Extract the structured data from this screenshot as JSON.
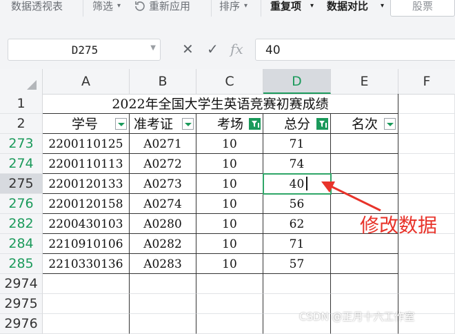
{
  "ribbon": {
    "items": [
      {
        "label": "数据透视表"
      },
      {
        "label": "筛选"
      },
      {
        "label": "重新应用"
      },
      {
        "label": "排序"
      },
      {
        "label": "重复项"
      },
      {
        "label": "数据对比"
      }
    ],
    "search_label": "股票"
  },
  "formula_bar": {
    "name_box": "D275",
    "value": "40",
    "cancel_icon": "close-icon",
    "confirm_icon": "check-icon",
    "function_icon": "fx-icon"
  },
  "columns": [
    "A",
    "B",
    "C",
    "D",
    "E",
    "F"
  ],
  "active_column": "D",
  "rows": [
    "1",
    "2",
    "273",
    "274",
    "275",
    "276",
    "282",
    "284",
    "285",
    "2974",
    "2975",
    "2976"
  ],
  "active_row": "275",
  "sheet": {
    "title": "2022年全国大学生英语竞赛初赛成绩",
    "headers": [
      "学号",
      "准考证",
      "考场",
      "总分",
      "名次"
    ],
    "filtered_columns": [
      "考场",
      "总分"
    ],
    "records": [
      {
        "id": "2200110125",
        "ticket": "A0271",
        "room": "10",
        "score": "71",
        "rank": ""
      },
      {
        "id": "2200110113",
        "ticket": "A0272",
        "room": "10",
        "score": "74",
        "rank": ""
      },
      {
        "id": "2200120133",
        "ticket": "A0273",
        "room": "10",
        "score": "40",
        "rank": ""
      },
      {
        "id": "2200120158",
        "ticket": "A0274",
        "room": "10",
        "score": "56",
        "rank": ""
      },
      {
        "id": "2200430103",
        "ticket": "A0280",
        "room": "10",
        "score": "62",
        "rank": ""
      },
      {
        "id": "2210910106",
        "ticket": "A0282",
        "room": "10",
        "score": "71",
        "rank": ""
      },
      {
        "id": "2210330136",
        "ticket": "A0283",
        "room": "10",
        "score": "57",
        "rank": ""
      }
    ]
  },
  "annotation": {
    "text": "修改数据",
    "color": "#e8332a"
  },
  "watermark": "CSDN @正月十六工作室",
  "colors": {
    "accent": "#1b9a5b",
    "selection": "#2ea567"
  }
}
